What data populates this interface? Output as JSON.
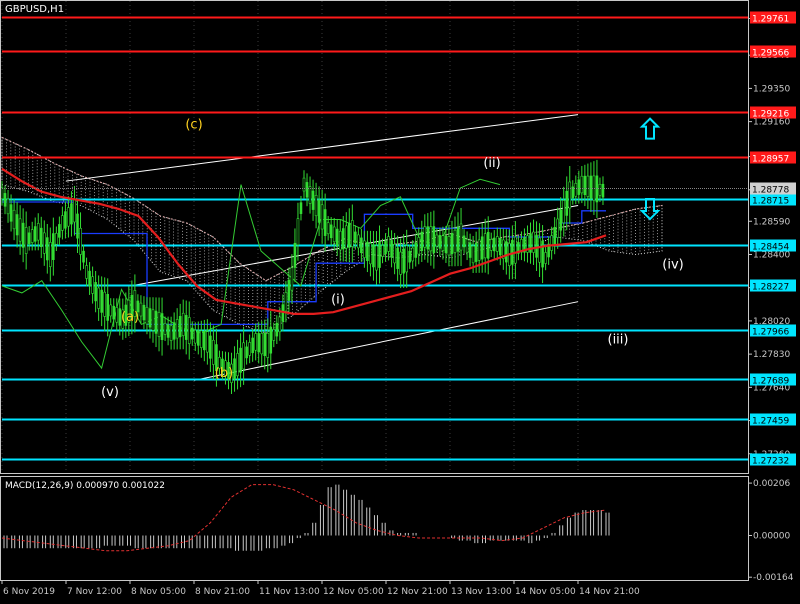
{
  "colors": {
    "background": "#000000",
    "grid": "#3a3a3a",
    "axis": "#c8c8c8",
    "candle": "#33dd33",
    "red_level": "#ff1a1a",
    "cyan_level": "#00e5ff",
    "moving_average": "#e41e1e",
    "kijun": "#1a3cff",
    "chikou": "#33cc33",
    "cloud": "#d8d8d8",
    "channel": "#ffffff",
    "wave_yellow": "#ffd21f",
    "wave_white": "#ffffff",
    "macd_hist": "#c8c8c8",
    "macd_signal": "#e03030"
  },
  "chart_data": {
    "type": "candlestick",
    "symbol_label": "GBPUSD,H1",
    "price_ticks": [
      "1.29750",
      "1.29540",
      "1.29350",
      "1.29160",
      "1.28960",
      "1.28770",
      "1.28590",
      "1.28400",
      "1.28210",
      "1.28020",
      "1.27830",
      "1.27640",
      "1.27450",
      "1.27260"
    ],
    "ylim": [
      1.2715,
      1.2985
    ],
    "x_labels": [
      "6 Nov 2019",
      "7 Nov 12:00",
      "8 Nov 05:00",
      "8 Nov 21:00",
      "11 Nov 13:00",
      "12 Nov 05:00",
      "12 Nov 21:00",
      "13 Nov 13:00",
      "14 Nov 05:00",
      "14 Nov 21:00"
    ],
    "levels": [
      {
        "price": 1.29761,
        "label": "1.29761",
        "color": "red"
      },
      {
        "price": 1.29566,
        "label": "1.29566",
        "color": "red"
      },
      {
        "price": 1.29216,
        "label": "1.29216",
        "color": "red"
      },
      {
        "price": 1.28957,
        "label": "1.28957",
        "color": "red"
      },
      {
        "price": 1.28715,
        "label": "1.28715",
        "color": "cyan"
      },
      {
        "price": 1.28454,
        "label": "1.28454",
        "color": "cyan"
      },
      {
        "price": 1.28227,
        "label": "1.28227",
        "color": "cyan"
      },
      {
        "price": 1.27966,
        "label": "1.27966",
        "color": "cyan"
      },
      {
        "price": 1.27689,
        "label": "1.27689",
        "color": "cyan"
      },
      {
        "price": 1.27459,
        "label": "1.27459",
        "color": "cyan"
      },
      {
        "price": 1.27232,
        "label": "1.27232",
        "color": "cyan"
      }
    ],
    "current_price": {
      "price": 1.28778,
      "label": "1.28778"
    },
    "close_series": [
      1.2875,
      1.286,
      1.2848,
      1.2853,
      1.284,
      1.2858,
      1.2865,
      1.283,
      1.2815,
      1.2808,
      1.2803,
      1.2812,
      1.2805,
      1.28,
      1.2795,
      1.28,
      1.2793,
      1.279,
      1.2778,
      1.2772,
      1.2782,
      1.279,
      1.2788,
      1.28,
      1.2826,
      1.288,
      1.2868,
      1.2855,
      1.2848,
      1.2852,
      1.2843,
      1.2838,
      1.2846,
      1.2835,
      1.284,
      1.285,
      1.2848,
      1.2845,
      1.285,
      1.284,
      1.2845,
      1.2846,
      1.284,
      1.2845,
      1.2847,
      1.2838,
      1.2855,
      1.2874,
      1.288,
      1.2878,
      1.2876
    ],
    "moving_average": [
      1.2889,
      1.2882,
      1.2876,
      1.2873,
      1.2871,
      1.2869,
      1.2866,
      1.2862,
      1.285,
      1.2835,
      1.2822,
      1.2814,
      1.2812,
      1.281,
      1.2808,
      1.2806,
      1.2806,
      1.2807,
      1.281,
      1.2813,
      1.2816,
      1.2819,
      1.2824,
      1.2829,
      1.2832,
      1.2836,
      1.284,
      1.2843,
      1.2845,
      1.2846,
      1.2847,
      1.2851
    ],
    "kijun": [
      1.287,
      1.287,
      1.287,
      1.2852,
      1.2852,
      1.2852,
      1.28,
      1.28,
      1.28,
      1.28,
      1.28,
      1.2813,
      1.2813,
      1.2835,
      1.2835,
      1.2863,
      1.2863,
      1.2855,
      1.2855,
      1.2855,
      1.2855,
      1.285,
      1.285,
      1.2858,
      1.2865,
      1.2865
    ],
    "chikou": [
      1.2822,
      1.2818,
      1.2825,
      1.2808,
      1.279,
      1.2775,
      1.282,
      1.28,
      1.2805,
      1.2798,
      1.2795,
      1.28,
      1.288,
      1.2842,
      1.2832,
      1.2822,
      1.286,
      1.286,
      1.2855,
      1.2868,
      1.2873,
      1.2848,
      1.2845,
      1.2878,
      1.2883,
      1.288
    ],
    "cloud_upper": [
      1.2907,
      1.29,
      1.2892,
      1.2885,
      1.288,
      1.2872,
      1.2862,
      1.2858,
      1.285,
      1.2835,
      1.2825,
      1.2833,
      1.2842,
      1.2849,
      1.2845,
      1.2846,
      1.2848,
      1.2852,
      1.2847,
      1.285,
      1.2852,
      1.2855,
      1.2858,
      1.2862,
      1.2866,
      1.2868
    ],
    "cloud_lower": [
      1.288,
      1.2876,
      1.287,
      1.2868,
      1.286,
      1.2848,
      1.283,
      1.2825,
      1.2808,
      1.28,
      1.2795,
      1.2805,
      1.2818,
      1.283,
      1.284,
      1.2838,
      1.284,
      1.2838,
      1.2842,
      1.2846,
      1.2845,
      1.285,
      1.2848,
      1.2842,
      1.284,
      1.2842
    ],
    "channel_lines": [
      {
        "from": [
          "7 Nov 12:00",
          1.2882
        ],
        "to": [
          "14 Nov 21:00",
          1.292
        ]
      },
      {
        "from": [
          "8 Nov 05:00",
          1.2822
        ],
        "to": [
          "14 Nov 21:00",
          1.2868
        ]
      },
      {
        "from": [
          "8 Nov 21:00",
          1.2768
        ],
        "to": [
          "14 Nov 21:00",
          1.2813
        ]
      }
    ],
    "wave_labels": [
      {
        "text": "(c)",
        "color": "yellow",
        "x": "8 Nov 21:00",
        "y": 1.2912
      },
      {
        "text": "(a)",
        "color": "yellow",
        "x": "8 Nov 05:00",
        "y": 1.2802
      },
      {
        "text": "(b)",
        "color": "yellow",
        "x": "8 Nov 21:00",
        "y": 1.277
      },
      {
        "text": "(v)",
        "color": "white",
        "x": "8 Nov 05:00",
        "y": 1.2759
      },
      {
        "text": "(i)",
        "color": "white",
        "x": "12 Nov 05:00",
        "y": 1.2812
      },
      {
        "text": "(ii)",
        "color": "white",
        "x": "14 Nov 05:00",
        "y": 1.289
      },
      {
        "text": "(iii)",
        "color": "white",
        "x": "14 Nov 21:00",
        "y": 1.2789
      },
      {
        "text": "(iv)",
        "color": "white",
        "x": "14 Nov 21:00",
        "y": 1.2832
      }
    ],
    "arrows": [
      {
        "direction": "up",
        "price": 1.2912
      },
      {
        "direction": "down",
        "price": 1.2866
      }
    ],
    "macd": {
      "label": "MACD(12,26,9) 0.000970 0.001022",
      "ticks": [
        "0.00206",
        "0.00000",
        "-0.00164"
      ],
      "ylim": [
        -0.00175,
        0.0023
      ],
      "histogram": [
        -0.0005,
        -0.0005,
        -0.0005,
        -0.0005,
        -0.0005,
        -0.0005,
        -0.0005,
        -0.0005,
        -0.0005,
        -0.0005,
        -0.0005,
        -0.0005,
        -0.0005,
        -0.0004,
        -0.0004,
        -0.0004,
        -0.0004,
        -0.0005,
        -0.0005,
        -0.0005,
        -0.0005,
        -0.0005,
        -0.0005,
        -0.0005,
        -0.0005,
        -0.0005,
        -0.0005,
        -0.0005,
        -0.0005,
        -0.0005,
        -0.0006,
        -0.0006,
        -0.0006,
        -0.0006,
        -0.0005,
        -0.0005,
        -0.0004,
        -0.0003,
        -0.0001,
        0.0001,
        0.0005,
        0.0012,
        0.0019,
        0.002,
        0.0018,
        0.0016,
        0.0014,
        0.0011,
        0.0008,
        0.0005,
        0.0002,
        0.0001,
        0.0001,
        0.0001,
        0.0,
        0.0,
        0.0,
        0.0,
        -0.0001,
        -0.0002,
        -0.0002,
        -0.0003,
        -0.0003,
        -0.0002,
        -0.0002,
        -0.0002,
        -0.0002,
        -0.0002,
        -0.0003,
        -0.0002,
        -0.0001,
        0.0001,
        0.0004,
        0.0007,
        0.0009,
        0.001,
        0.001,
        0.001,
        0.0009
      ],
      "signal": [
        -0.0001,
        -0.0002,
        -0.0003,
        -0.0004,
        -0.0005,
        -0.0006,
        -0.0006,
        -0.0005,
        -0.0004,
        -0.0002,
        0.0005,
        0.0015,
        0.002,
        0.002,
        0.0018,
        0.0014,
        0.001,
        0.0005,
        0.0002,
        0.0,
        -0.0001,
        -0.0001,
        -0.0001,
        -0.0001,
        -0.0002,
        -0.0001,
        0.0003,
        0.0007,
        0.0009,
        0.001
      ]
    }
  }
}
